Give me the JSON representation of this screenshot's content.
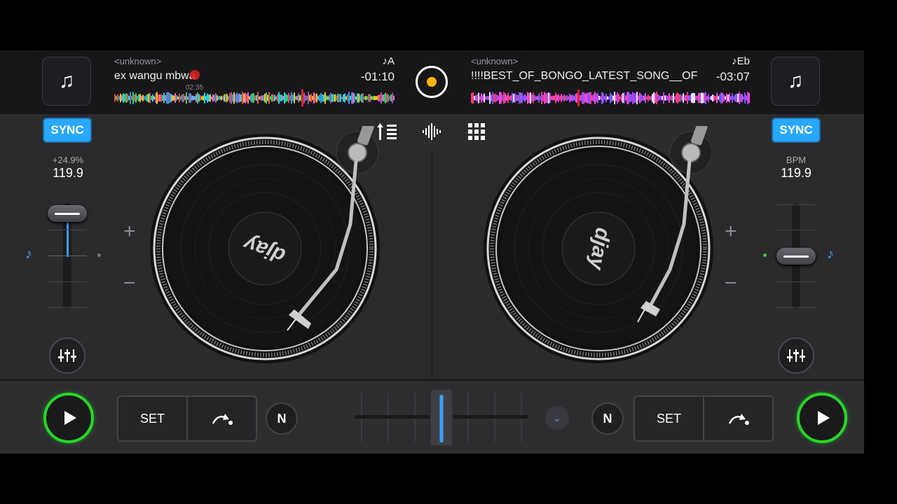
{
  "colors": {
    "accent": "#29a8ff",
    "play_ring": "#29d529",
    "rec_dot": "#ffb400",
    "playhead": "#e02020"
  },
  "left_deck": {
    "library_icon": "music-note-icon",
    "artist": "<unknown>",
    "title": "ex wangu mbwa",
    "overlay_time": "02:35",
    "key": "♪A",
    "remaining_time": "-01:10",
    "sync_label": "SYNC",
    "pitch_label": "+24.9%",
    "bpm": "119.9",
    "platter_logo": "djay",
    "plus": "+",
    "minus": "−",
    "set_label": "SET",
    "n_label": "N"
  },
  "right_deck": {
    "library_icon": "music-note-icon",
    "artist": "<unknown>",
    "title": "!!!!BEST_OF_BONGO_LATEST_SONG__OF",
    "key": "♪Eb",
    "remaining_time": "-03:07",
    "sync_label": "SYNC",
    "pitch_label": "BPM",
    "bpm": "119.9",
    "platter_logo": "djay",
    "plus": "+",
    "minus": "−",
    "set_label": "SET",
    "n_label": "N"
  },
  "center": {
    "record_icon": "record-icon",
    "waveform_icon": "waveform-icon",
    "grid_icon": "grid-icon",
    "library_list_icon": "library-list-icon",
    "chevron_icon": "chevron-down-icon"
  },
  "crossfader": {
    "position": 0.5
  }
}
